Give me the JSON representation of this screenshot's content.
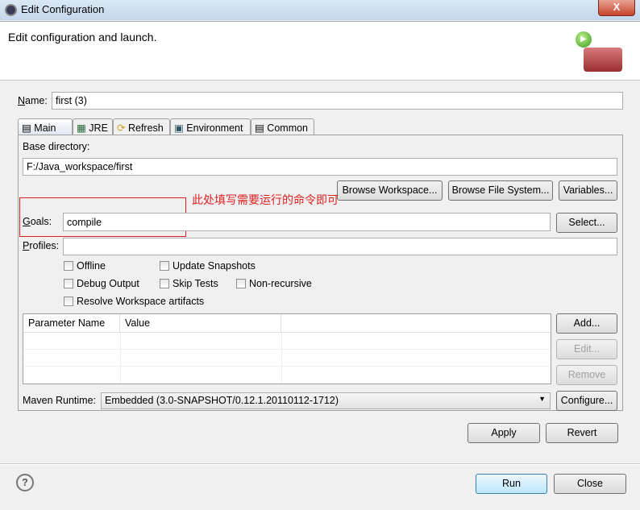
{
  "window": {
    "title": "Edit Configuration",
    "close": "X"
  },
  "header": {
    "text": "Edit configuration and launch."
  },
  "name": {
    "label": "Name:",
    "value": "first (3)"
  },
  "tabs": [
    {
      "label": "Main"
    },
    {
      "label": "JRE"
    },
    {
      "label": "Refresh"
    },
    {
      "label": "Environment"
    },
    {
      "label": "Common"
    }
  ],
  "main": {
    "base_dir_label": "Base directory:",
    "base_dir_value": "F:/Java_workspace/first",
    "browse_workspace": "Browse Workspace...",
    "browse_fs": "Browse File System...",
    "variables": "Variables...",
    "annotation": "此处填写需要运行的命令即可",
    "annotation_color": "#e02020",
    "goals_label": "Goals:",
    "goals_value": "compile",
    "select": "Select...",
    "profiles_label": "Profiles:",
    "profiles_value": "",
    "checkboxes": [
      {
        "label": "Offline",
        "checked": false
      },
      {
        "label": "Update Snapshots",
        "checked": false
      },
      {
        "label": "Debug Output",
        "checked": false
      },
      {
        "label": "Skip Tests",
        "checked": false
      },
      {
        "label": "Non-recursive",
        "checked": false
      },
      {
        "label": "Resolve Workspace artifacts",
        "checked": false
      }
    ],
    "table": {
      "columns": [
        "Parameter Name",
        "Value"
      ],
      "rows": []
    },
    "add": "Add...",
    "edit": "Edit...",
    "remove": "Remove",
    "runtime_label": "Maven Runtime:",
    "runtime_value": "Embedded (3.0-SNAPSHOT/0.12.1.20110112-1712)",
    "configure": "Configure..."
  },
  "apply": "Apply",
  "revert": "Revert",
  "run": "Run",
  "close": "Close",
  "help": "?"
}
